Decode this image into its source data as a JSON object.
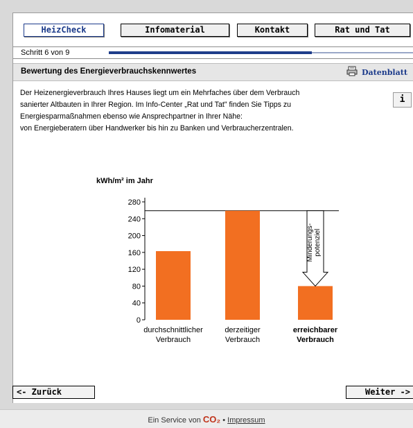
{
  "nav": {
    "heizcheck": "HeizCheck",
    "infomaterial": "Infomaterial",
    "kontakt": "Kontakt",
    "rat_und_tat": "Rat und Tat"
  },
  "step": {
    "text": "Schritt 6 von 9",
    "progress": 0.667
  },
  "section": {
    "title": "Bewertung des Energieverbrauchskennwertes",
    "datasheet_label": "Datenblatt"
  },
  "intro_lines": [
    "Der Heizenergieverbrauch Ihres Hauses liegt um ein Mehrfaches über dem Verbrauch",
    "sanierter Altbauten in Ihrer Region. Im Info-Center „Rat und Tat\" finden Sie Tipps zu",
    "Energiesparmaßnahmen ebenso wie Ansprechpartner in Ihrer Nähe:",
    "von Energieberatern über Handwerker bis hin zu Banken und Verbraucherzentralen."
  ],
  "info_button": "i",
  "chart_data": {
    "type": "bar",
    "ylabel": "kWh/m² im Jahr",
    "ylim": [
      0,
      280
    ],
    "yticks": [
      0,
      40,
      80,
      120,
      160,
      200,
      240,
      280
    ],
    "categories": [
      [
        "durchschnittlicher",
        "Verbrauch"
      ],
      [
        "derzeitiger",
        "Verbrauch"
      ],
      [
        "erreichbarer",
        "Verbrauch"
      ]
    ],
    "values": [
      163,
      259,
      80
    ],
    "reference_line": 259,
    "annotation": [
      "Minderungs-",
      "potenziel"
    ],
    "bar_color": "#f26f21",
    "bold_category_index": 2
  },
  "buttons": {
    "back": "<- Zurück",
    "next": "Weiter ->"
  },
  "footer": {
    "prefix": "Ein Service von",
    "logo": "CO₂",
    "separator": "•",
    "link": "Impressum"
  }
}
